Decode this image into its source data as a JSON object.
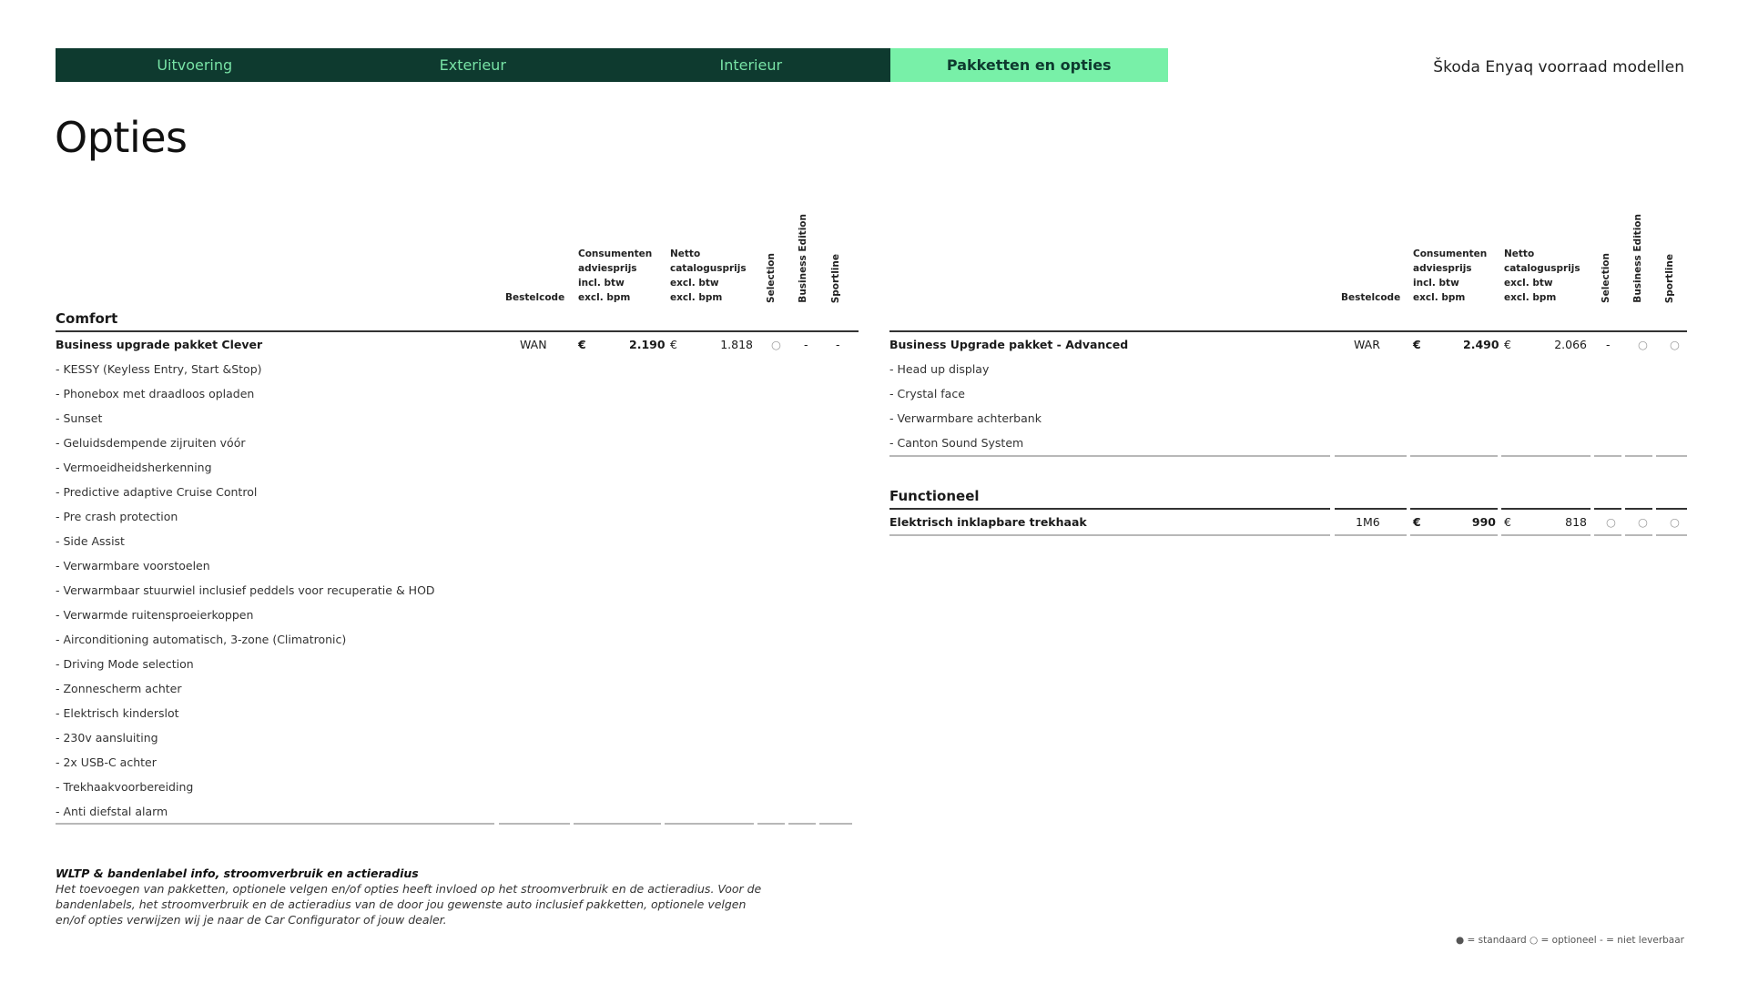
{
  "tabs": [
    {
      "label": "Uitvoering",
      "active": false
    },
    {
      "label": "Exterieur",
      "active": false
    },
    {
      "label": "Interieur",
      "active": false
    },
    {
      "label": "Pakketten en opties",
      "active": true
    }
  ],
  "doc_title": "Škoda Enyaq voorraad modellen",
  "page_title": "Opties",
  "columns": {
    "bestelcode": "Bestelcode",
    "consumentenprijs": [
      "Consumenten",
      "adviesprijs",
      "incl. btw",
      "excl. bpm"
    ],
    "nettoprijs": [
      "Netto",
      "catalogusprijs",
      "excl. btw",
      "excl. bpm"
    ],
    "selection": "Selection",
    "business_edition": "Business Edition",
    "sportline": "Sportline",
    "currency": "€"
  },
  "left_table": {
    "section": "Comfort",
    "package": {
      "name": "Business upgrade pakket Clever",
      "code": "WAN",
      "consumer_price": "2.190",
      "net_price": "1.818",
      "selection": "○",
      "business_edition": "-",
      "sportline": "-"
    },
    "items": [
      "- KESSY (Keyless Entry, Start &Stop)",
      "- Phonebox met draadloos opladen",
      "- Sunset",
      "- Geluidsdempende zijruiten vóór",
      "- Vermoeidheidsherkenning",
      "- Predictive adaptive Cruise Control",
      "- Pre crash protection",
      "- Side Assist",
      "- Verwarmbare voorstoelen",
      "- Verwarmbaar stuurwiel inclusief peddels voor recuperatie & HOD",
      "- Verwarmde ruitensproeierkoppen",
      "- Airconditioning automatisch, 3-zone (Climatronic)",
      "- Driving Mode selection",
      "- Zonnescherm achter",
      "- Elektrisch kinderslot",
      "- 230v aansluiting",
      "- 2x USB-C achter",
      "- Trekhaakvoorbereiding",
      "- Anti diefstal alarm"
    ]
  },
  "right_table": {
    "package": {
      "name": "Business Upgrade pakket - Advanced",
      "code": "WAR",
      "consumer_price": "2.490",
      "net_price": "2.066",
      "selection": "-",
      "business_edition": "○",
      "sportline": "○"
    },
    "items": [
      "- Head up display",
      "- Crystal face",
      "- Verwarmbare achterbank",
      "- Canton Sound System"
    ],
    "section2": "Functioneel",
    "option": {
      "name": "Elektrisch inklapbare trekhaak",
      "code": "1M6",
      "consumer_price": "990",
      "net_price": "818",
      "selection": "○",
      "business_edition": "○",
      "sportline": "○"
    }
  },
  "note": {
    "title": "WLTP & bandenlabel info, stroomverbruik en actieradius",
    "body": "Het toevoegen van pakketten, optionele velgen en/of opties heeft invloed op het stroomverbruik en de actieradius. Voor de bandenlabels, het stroomverbruik en de actieradius van de door jou gewenste auto inclusief pakketten, optionele velgen en/of opties verwijzen wij je naar de Car Configurator of jouw dealer."
  },
  "legend": "● = standaard   ○ = optioneel   - = niet leverbaar"
}
